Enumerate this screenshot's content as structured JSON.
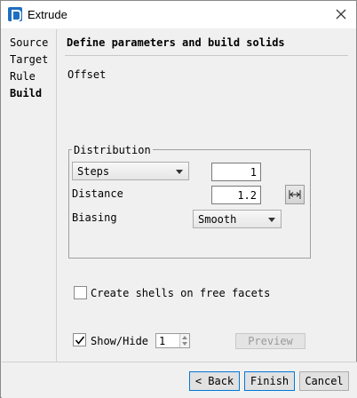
{
  "window": {
    "title": "Extrude",
    "app_icon": "app-logo-icon",
    "close_icon": "close-icon"
  },
  "nav": {
    "items": [
      {
        "label": "Source"
      },
      {
        "label": "Target"
      },
      {
        "label": "Rule"
      },
      {
        "label": "Build",
        "active": true
      }
    ]
  },
  "main": {
    "section_title": "Define parameters and build solids",
    "offset_label": "Offset",
    "distribution": {
      "legend": "Distribution",
      "method_selected": "Steps",
      "steps_value": "1",
      "distance_label": "Distance",
      "distance_value": "1.2",
      "range_icon": "range-width-icon",
      "biasing_label": "Biasing",
      "biasing_selected": "Smooth"
    },
    "create_shells": {
      "label": "Create shells on free facets",
      "checked": false
    },
    "show_hide": {
      "label": "Show/Hide",
      "checked": true,
      "value": "1"
    },
    "preview_label": "Preview"
  },
  "footer": {
    "back_label": "< Back",
    "finish_label": "Finish",
    "cancel_label": "Cancel"
  }
}
